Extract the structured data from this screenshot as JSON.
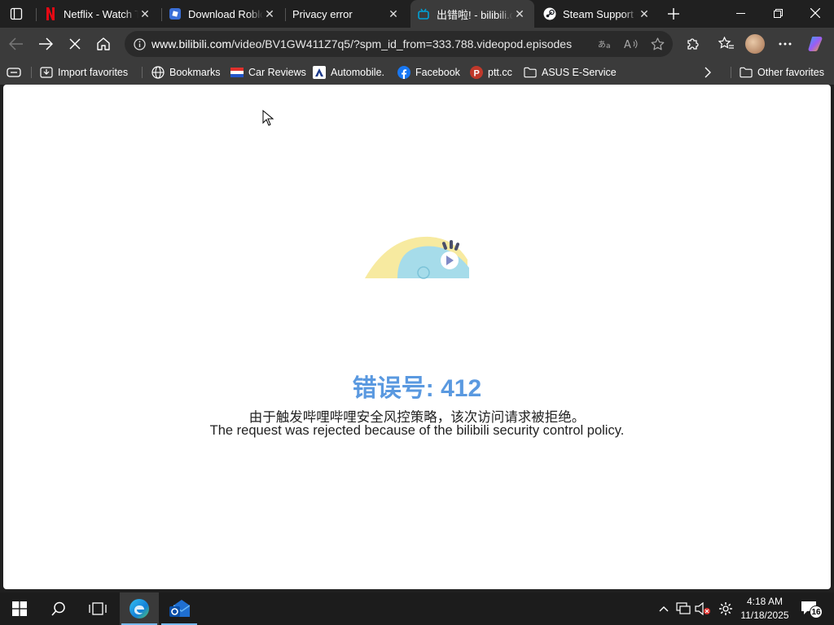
{
  "tabs": [
    {
      "title": "Netflix - Watch TV Shows Online",
      "icon": "netflix-icon"
    },
    {
      "title": "Download Roblox",
      "icon": "roblox-icon"
    },
    {
      "title": "Privacy error",
      "icon": ""
    },
    {
      "title": "出错啦! - bilibili.com",
      "icon": "bilibili-icon",
      "active": true
    },
    {
      "title": "Steam Support - Help",
      "icon": "steam-icon"
    }
  ],
  "address": {
    "host": "www.bilibili.com",
    "path": "/video/BV1GW411Z7q5/?spm_id_from=333.788.videopod.episodes"
  },
  "favorites": [
    {
      "label": "Import favorites",
      "icon": "import-icon"
    },
    {
      "label": "Bookmarks",
      "icon": "globe-icon"
    },
    {
      "label": "Car Reviews",
      "icon": "flag-icon"
    },
    {
      "label": "Automobile.",
      "icon": "automobile-icon"
    },
    {
      "label": "Facebook",
      "icon": "facebook-icon"
    },
    {
      "label": "ptt.cc",
      "icon": "ptt-icon"
    },
    {
      "label": "ASUS E-Service",
      "icon": "folder-icon"
    }
  ],
  "other_favorites": "Other favorites",
  "error": {
    "code": "错误号: 412",
    "message_zh": "由于触发哔哩哔哩安全风控策略，该次访问请求被拒绝。",
    "message_en": "The request was rejected because of the bilibili security control policy."
  },
  "clock": {
    "time": "4:18 AM",
    "date": "11/18/2025"
  },
  "notifications_count": "16",
  "colors": {
    "accent": "#5a99e0",
    "bilibili": "#00a1d6",
    "netflix": "#e50914"
  }
}
